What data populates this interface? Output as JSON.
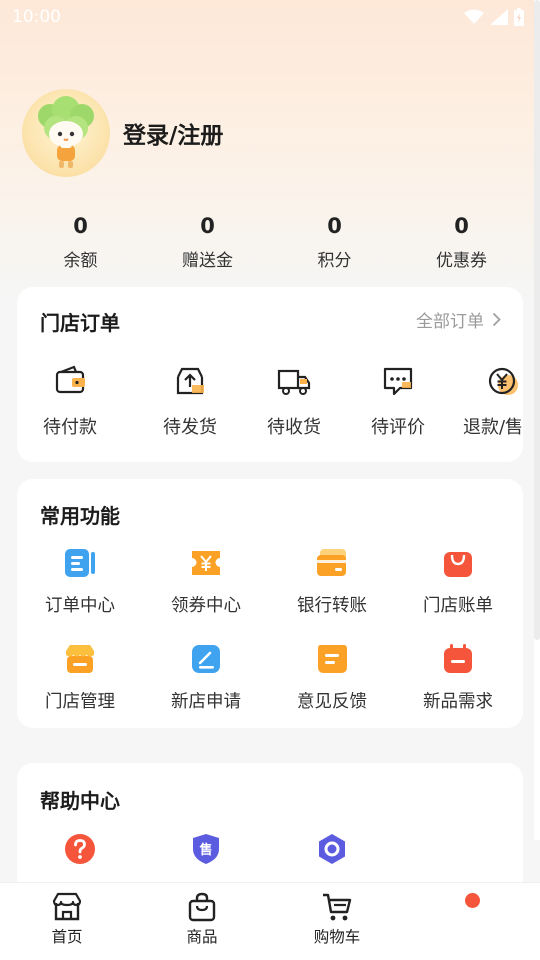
{
  "status_bar": {
    "time": "10:00",
    "icons": [
      "wifi-icon",
      "signal-icon",
      "battery-icon"
    ]
  },
  "profile": {
    "login_label": "登录/注册",
    "avatar_icon": "broccoli-mascot-avatar"
  },
  "stats": [
    {
      "value": "0",
      "label": "余额"
    },
    {
      "value": "0",
      "label": "赠送金"
    },
    {
      "value": "0",
      "label": "积分"
    },
    {
      "value": "0",
      "label": "优惠券"
    }
  ],
  "store_orders": {
    "title": "门店订单",
    "all_orders_label": "全部订单",
    "items": [
      {
        "label": "待付款",
        "icon": "wallet-icon"
      },
      {
        "label": "待发货",
        "icon": "box-upload-icon"
      },
      {
        "label": "待收货",
        "icon": "truck-icon"
      },
      {
        "label": "待评价",
        "icon": "comment-icon"
      },
      {
        "label": "退款/售后",
        "icon": "yuan-coin-icon"
      }
    ]
  },
  "common_functions": {
    "title": "常用功能",
    "items": [
      {
        "label": "订单中心",
        "icon": "order-list-icon"
      },
      {
        "label": "领券中心",
        "icon": "coupon-icon"
      },
      {
        "label": "银行转账",
        "icon": "bank-card-icon"
      },
      {
        "label": "门店账单",
        "icon": "shopping-bag-icon"
      },
      {
        "label": "门店管理",
        "icon": "store-icon"
      },
      {
        "label": "新店申请",
        "icon": "edit-icon"
      },
      {
        "label": "意见反馈",
        "icon": "feedback-icon"
      },
      {
        "label": "新品需求",
        "icon": "calendar-icon"
      }
    ]
  },
  "help_center": {
    "title": "帮助中心",
    "items": [
      {
        "icon": "question-icon"
      },
      {
        "icon": "after-sale-shield-icon",
        "badge_text": "售"
      },
      {
        "icon": "hexagon-ring-icon"
      }
    ]
  },
  "tabbar": [
    {
      "label": "首页",
      "icon": "home-store-icon"
    },
    {
      "label": "商品",
      "icon": "bag-icon"
    },
    {
      "label": "购物车",
      "icon": "cart-icon"
    }
  ],
  "colors": {
    "accent_red": "#f5553b",
    "accent_orange": "#fba126",
    "accent_blue": "#3fa3f0",
    "accent_purple": "#5b5ce0",
    "text_primary": "#1c1c1c",
    "text_secondary": "#9a9a9a"
  }
}
